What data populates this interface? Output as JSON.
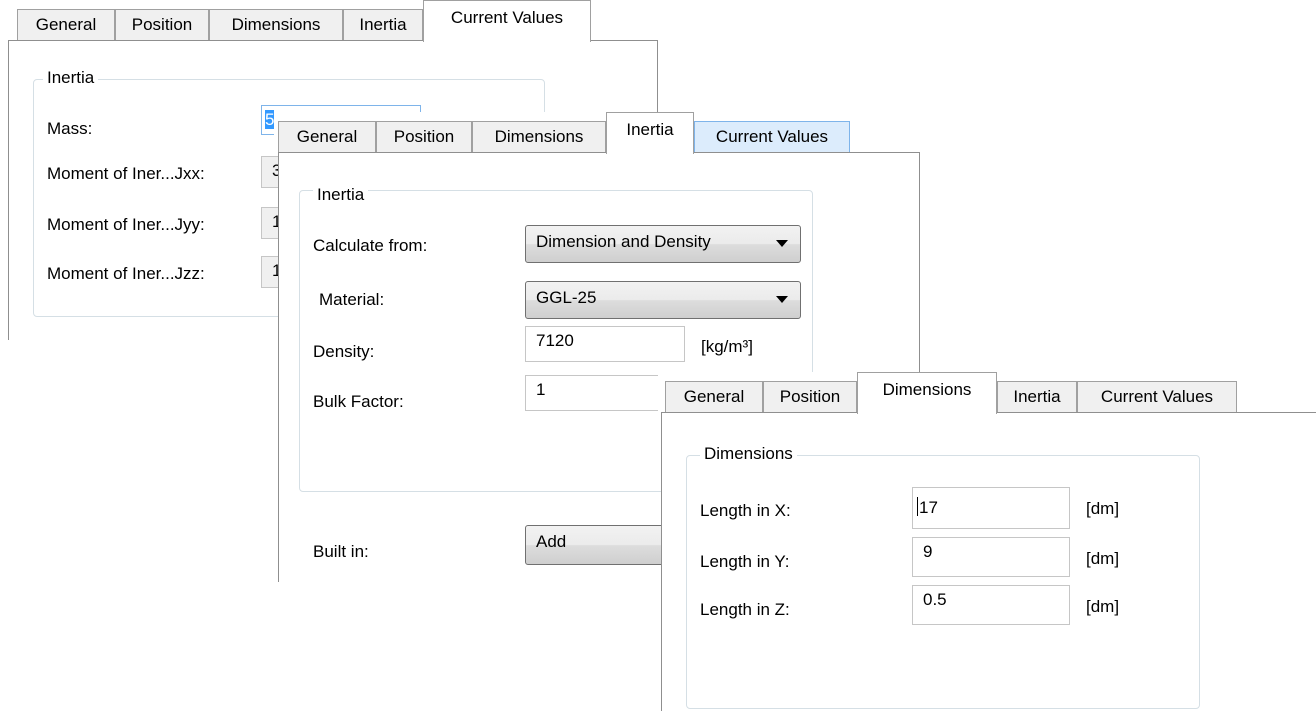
{
  "tab_labels": [
    "General",
    "Position",
    "Dimensions",
    "Inertia",
    "Current Values"
  ],
  "back_dialog": {
    "group_title": "Inertia",
    "rows": [
      {
        "label": "Mass:",
        "value": "5"
      },
      {
        "label": "Moment of Iner...Jxx:",
        "value": "3"
      },
      {
        "label": "Moment of Iner...Jyy:",
        "value": "1"
      },
      {
        "label": "Moment of Iner...Jzz:",
        "value": "1"
      }
    ]
  },
  "middle_dialog": {
    "group_title": "Inertia",
    "calculate_from": {
      "label": "Calculate from:",
      "value": "Dimension and Density"
    },
    "material": {
      "label": "Material:",
      "value": "GGL-25"
    },
    "density": {
      "label": "Density:",
      "value": "7120",
      "unit": "[kg/m³]"
    },
    "bulk_factor": {
      "label": "Bulk Factor:",
      "value": "1"
    },
    "built_in": {
      "label": "Built in:",
      "value": "Add"
    }
  },
  "front_dialog": {
    "group_title": "Dimensions",
    "rows": [
      {
        "label": "Length in X:",
        "value": "17",
        "unit": "[dm]"
      },
      {
        "label": "Length in Y:",
        "value": "9",
        "unit": "[dm]"
      },
      {
        "label": "Length in Z:",
        "value": "0.5",
        "unit": "[dm]"
      }
    ]
  },
  "colors": {
    "tab_hover": "#dcecfc",
    "selection": "#3399ff",
    "group_border": "#d5dfe5"
  }
}
